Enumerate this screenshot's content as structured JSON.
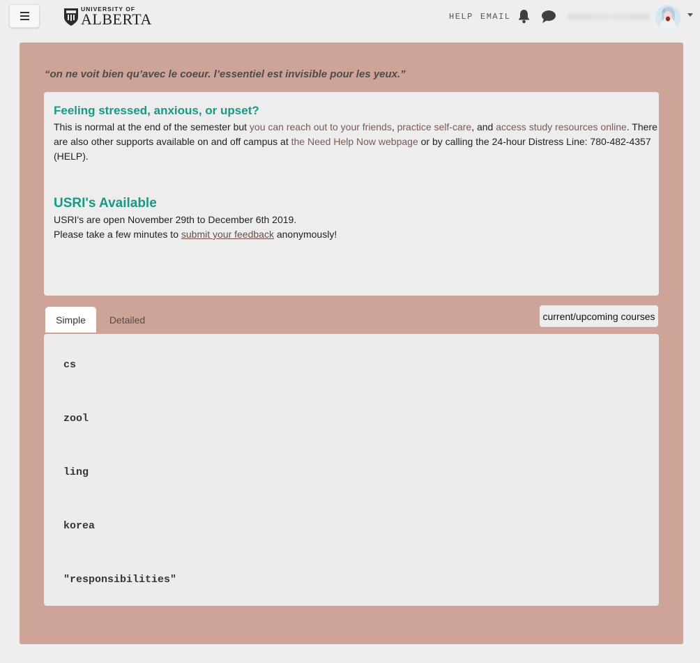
{
  "header": {
    "menu_icon": "hamburger-icon",
    "logo_small": "UNIVERSITY OF",
    "logo_big": "ALBERTA",
    "nav_help": "HELP",
    "nav_email": "EMAIL",
    "bell_icon": "bell-icon",
    "chat_icon": "chat-bubble-icon",
    "caret_icon": "caret-down-icon"
  },
  "quote": "“on ne voit bien qu’avec le coeur. l’essentiel est invisible pour les yeux.”",
  "announcements": {
    "stress_title": "Feeling stressed, anxious, or upset?",
    "stress_text_1": "This is normal at the end of the semester but ",
    "stress_link_1": "you can reach out to your friends",
    "stress_text_2": ", ",
    "stress_link_2": "practice self-care",
    "stress_text_3": ", and ",
    "stress_link_3": "access study resources online",
    "stress_text_4": ". There are also other supports available on and off campus at ",
    "stress_link_4": "the Need Help Now webpage",
    "stress_text_5": " or by calling the 24-hour Distress Line: 780-482-4357 (HELP).",
    "usri_title": "USRI's Available",
    "usri_line_1": "USRI's are open November 29th to December 6th 2019.",
    "usri_line_2_pre": "Please take a few minutes to ",
    "usri_link": "submit your feedback",
    "usri_line_2_post": " anonymously!"
  },
  "tabs": {
    "simple": "Simple",
    "detailed": "Detailed",
    "active": "Simple"
  },
  "current_upcoming_label": "current/upcoming courses",
  "courses": [
    "cs",
    "zool",
    "ling",
    "korea",
    "\"responsibilities\""
  ],
  "colors": {
    "panel": "#cea398",
    "heading": "#169a84",
    "background": "#eeeeee"
  }
}
